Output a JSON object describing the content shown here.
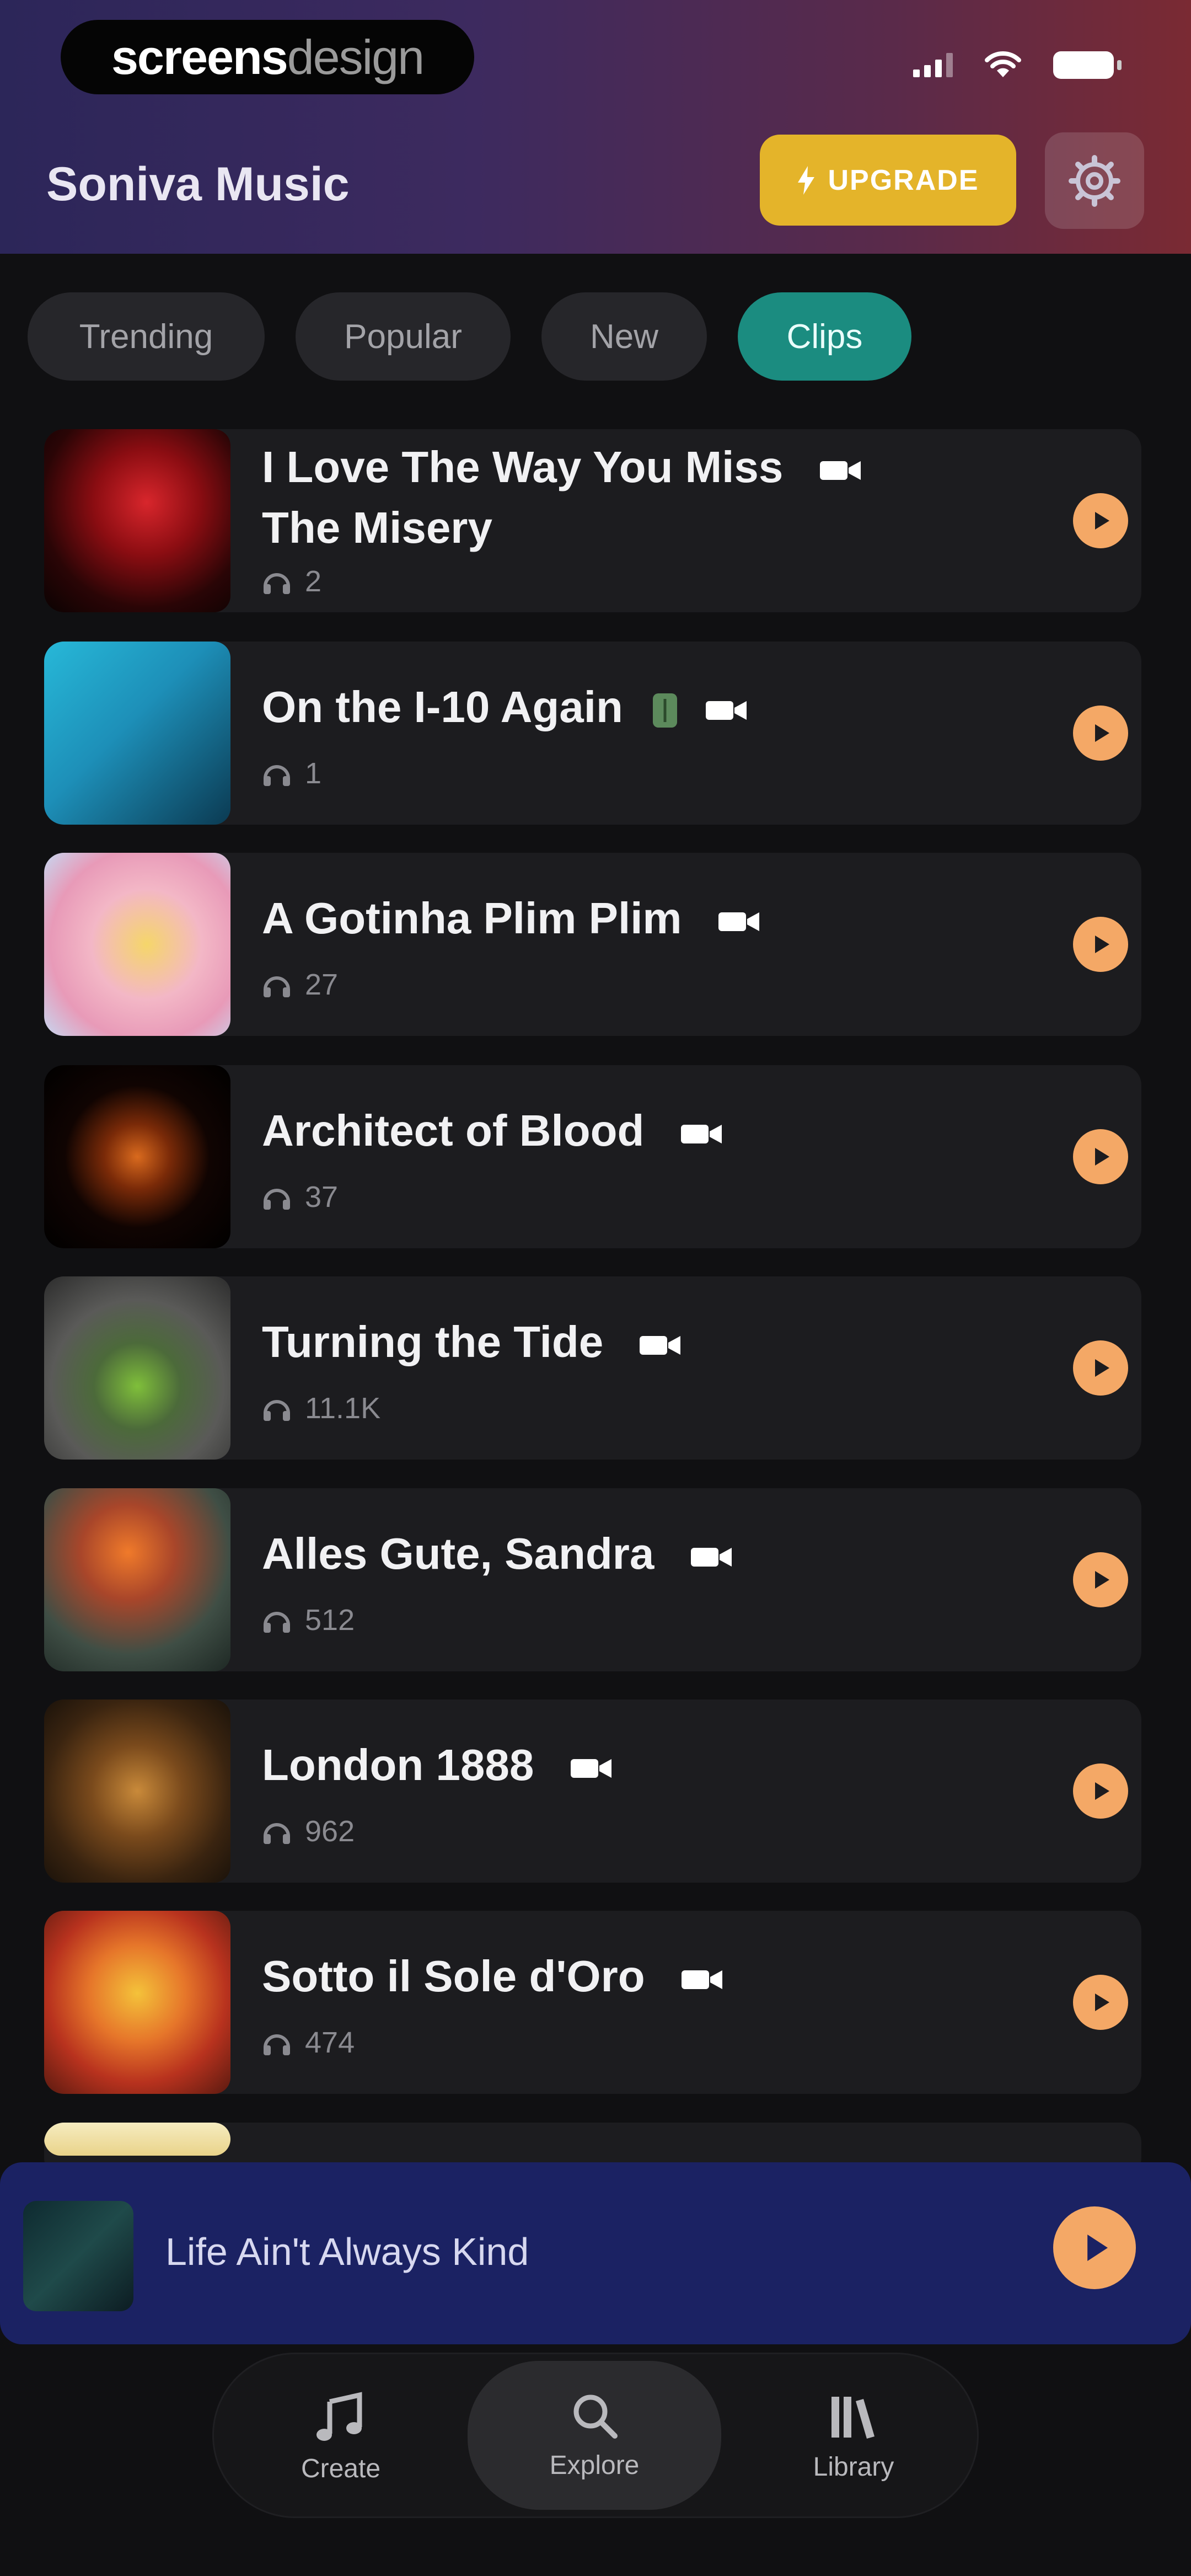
{
  "status": {
    "logo_a": "screens",
    "logo_b": "design"
  },
  "header": {
    "title": "Soniva Music",
    "upgrade_label": "UPGRADE",
    "colors": {
      "upgrade": "#e4b42a",
      "accent_play": "#f4a866",
      "chip_active": "#1b8c80"
    }
  },
  "filters": [
    {
      "label": "Trending",
      "active": false
    },
    {
      "label": "Popular",
      "active": false
    },
    {
      "label": "New",
      "active": false
    },
    {
      "label": "Clips",
      "active": true
    }
  ],
  "tracks": [
    {
      "title_line1": "I Love The Way You Miss",
      "title_line2": "The Misery",
      "plays": "2"
    },
    {
      "title_line1": "On the I-10 Again",
      "plays": "1",
      "extra_icon": "leaf-icon"
    },
    {
      "title_line1": "A Gotinha Plim Plim",
      "plays": "27"
    },
    {
      "title_line1": "Architect of Blood",
      "plays": "37"
    },
    {
      "title_line1": "Turning the Tide",
      "plays": "11.1K"
    },
    {
      "title_line1": "Alles Gute, Sandra",
      "plays": "512"
    },
    {
      "title_line1": "London 1888",
      "plays": "962"
    },
    {
      "title_line1": "Sotto il Sole d'Oro",
      "plays": "474"
    }
  ],
  "mini_player": {
    "title": "Life Ain't Always Kind"
  },
  "nav": {
    "create": "Create",
    "explore": "Explore",
    "library": "Library",
    "active": "Explore"
  }
}
